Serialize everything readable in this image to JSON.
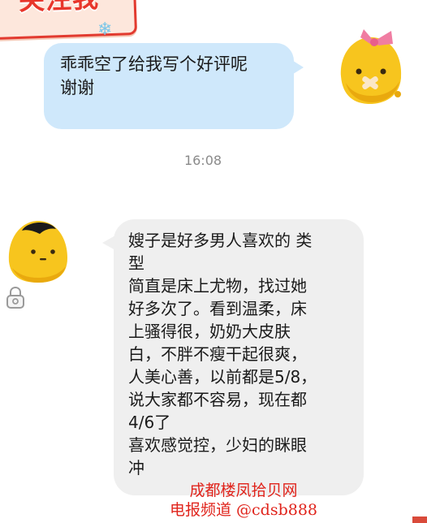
{
  "banner": {
    "text": "关注我"
  },
  "messages": {
    "outgoing_1": {
      "text": "乖乖空了给我写个好评呢\n谢谢"
    },
    "timestamp": "16:08",
    "incoming_1": {
      "text": "嫂子是好多男人喜欢的 类\n型\n简直是床上尤物，找过她\n好多次了。看到温柔，床\n上骚得很，奶奶大皮肤\n白，不胖不瘦干起很爽，\n人美心善，以前都是5/8，\n说大家都不容易，现在都\n4/6了\n喜欢感觉控，少妇的眯眼\n冲"
    }
  },
  "watermark": {
    "line1": "成都楼凤拾贝网",
    "line2": "电报频道 @cdsb888"
  },
  "icons": {
    "right_avatar": "yellow-blob-with-pink-bow-avatar",
    "left_avatar": "yellow-blob-with-black-hair-avatar",
    "lock": "lock-icon",
    "snowflake": "snowflake-icon"
  },
  "colors": {
    "outgoing_bubble": "#cfe8fb",
    "incoming_bubble": "#efefef",
    "avatar_yellow": "#f7c51e",
    "banner_red": "#e8362b",
    "watermark_red": "#e0231b"
  }
}
